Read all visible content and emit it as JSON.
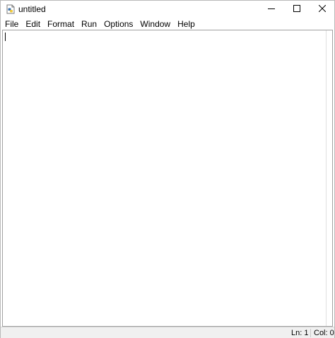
{
  "window": {
    "title": "untitled",
    "icon": "python-file-icon",
    "controls": [
      "minimize-icon",
      "maximize-icon",
      "close-icon"
    ]
  },
  "menu": {
    "items": [
      {
        "label": "File"
      },
      {
        "label": "Edit"
      },
      {
        "label": "Format"
      },
      {
        "label": "Run"
      },
      {
        "label": "Options"
      },
      {
        "label": "Window"
      },
      {
        "label": "Help"
      }
    ]
  },
  "editor": {
    "content": ""
  },
  "status": {
    "line": "Ln: 1",
    "column": "Col: 0"
  },
  "colors": {
    "window_bg": "#ffffff",
    "border": "#b9b9b9",
    "statusbar_bg": "#f0f0f0",
    "text": "#000000"
  }
}
